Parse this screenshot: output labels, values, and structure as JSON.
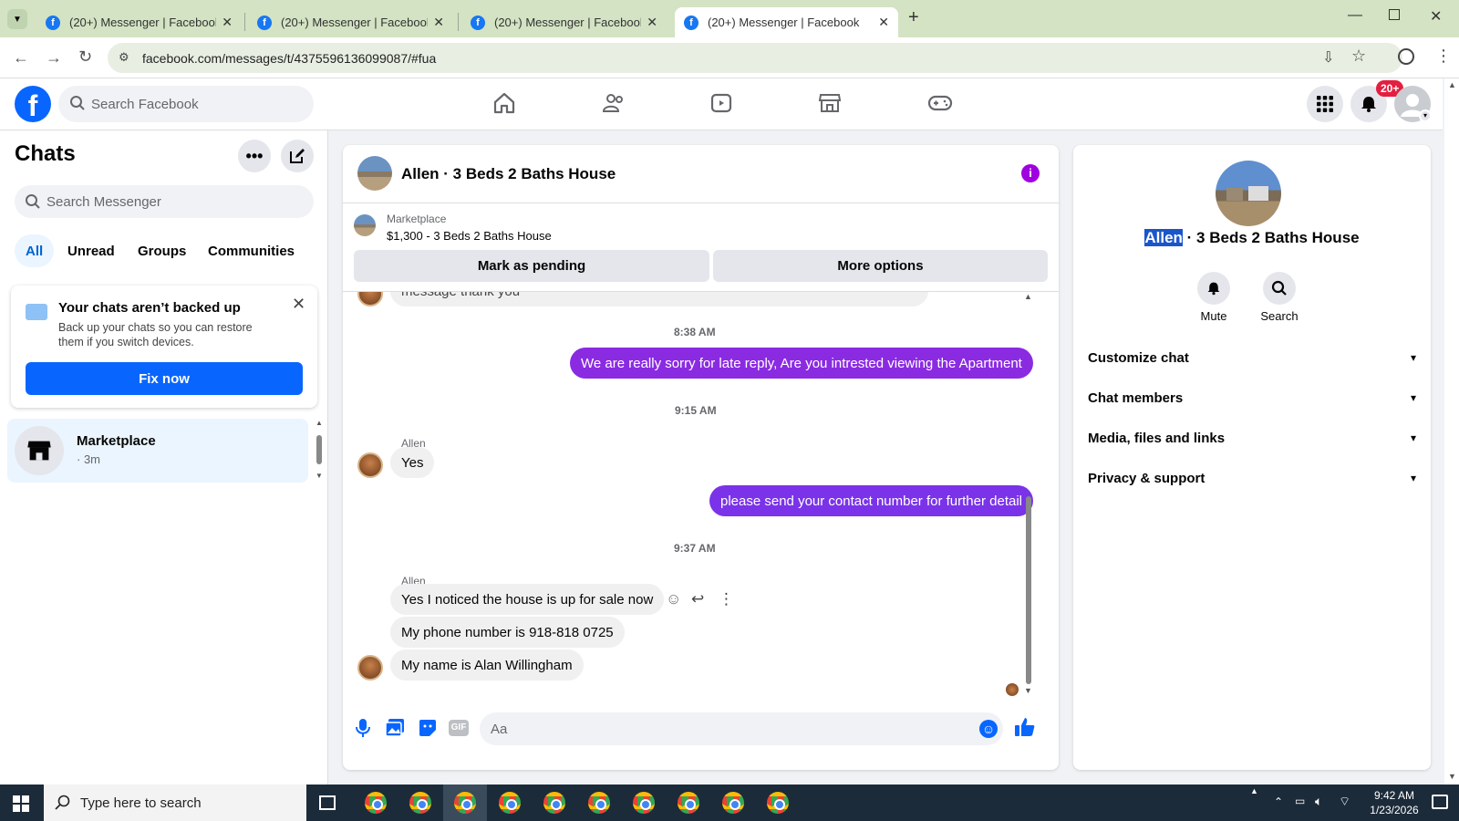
{
  "browser": {
    "tabs": [
      {
        "title": "(20+) Messenger | Facebook"
      },
      {
        "title": "(20+) Messenger | Facebook"
      },
      {
        "title": "(20+) Messenger | Facebook"
      },
      {
        "title": "(20+) Messenger | Facebook"
      }
    ],
    "url": "facebook.com/messages/t/4375596136099087/#fua"
  },
  "fb_header": {
    "search_placeholder": "Search Facebook",
    "notification_badge": "20+"
  },
  "left_panel": {
    "title": "Chats",
    "search_placeholder": "Search Messenger",
    "filters": [
      "All",
      "Unread",
      "Groups",
      "Communities"
    ],
    "backup_card": {
      "title": "Your chats aren’t backed up",
      "body": "Back up your chats so you can restore them if you switch devices.",
      "button": "Fix now"
    },
    "chat_item": {
      "name": "Marketplace",
      "meta": "· 3m"
    }
  },
  "conversation": {
    "title": "Allen · 3 Beds 2 Baths House",
    "listing_label": "Marketplace",
    "listing_price": "$1,300 - 3 Beds 2 Baths House",
    "mark_pending": "Mark as pending",
    "more_options": "More options",
    "partial_message": "message thank you",
    "messages": [
      {
        "type": "time",
        "text": "8:38 AM"
      },
      {
        "type": "out",
        "text": "We are really sorry for late reply, Are you intrested viewing the Apartment"
      },
      {
        "type": "time",
        "text": "9:15 AM"
      },
      {
        "type": "sender",
        "text": "Allen"
      },
      {
        "type": "in",
        "text": "Yes"
      },
      {
        "type": "out",
        "text": "please send your contact number for further detail"
      },
      {
        "type": "time",
        "text": "9:37 AM"
      },
      {
        "type": "sender",
        "text": "Allen"
      },
      {
        "type": "in",
        "text": "Yes I noticed the house is up for sale now"
      },
      {
        "type": "in",
        "text": "My phone number is 918-818 0725"
      },
      {
        "type": "in",
        "text": "My name is Alan Willingham"
      }
    ],
    "composer_placeholder": "Aa"
  },
  "right_panel": {
    "name_highlight": "Allen",
    "name_rest": " · 3 Beds 2 Baths House",
    "actions": [
      "Mute",
      "Search"
    ],
    "sections": [
      "Customize chat",
      "Chat members",
      "Media, files and links",
      "Privacy & support"
    ]
  },
  "taskbar": {
    "search_placeholder": "Type here to search",
    "time": "9:42 AM",
    "date": "1/23/2026"
  },
  "colors": {
    "fb_blue": "#0866ff",
    "outgoing_bubble": "#8a2be2",
    "tab_bar": "#d3e3c3"
  }
}
